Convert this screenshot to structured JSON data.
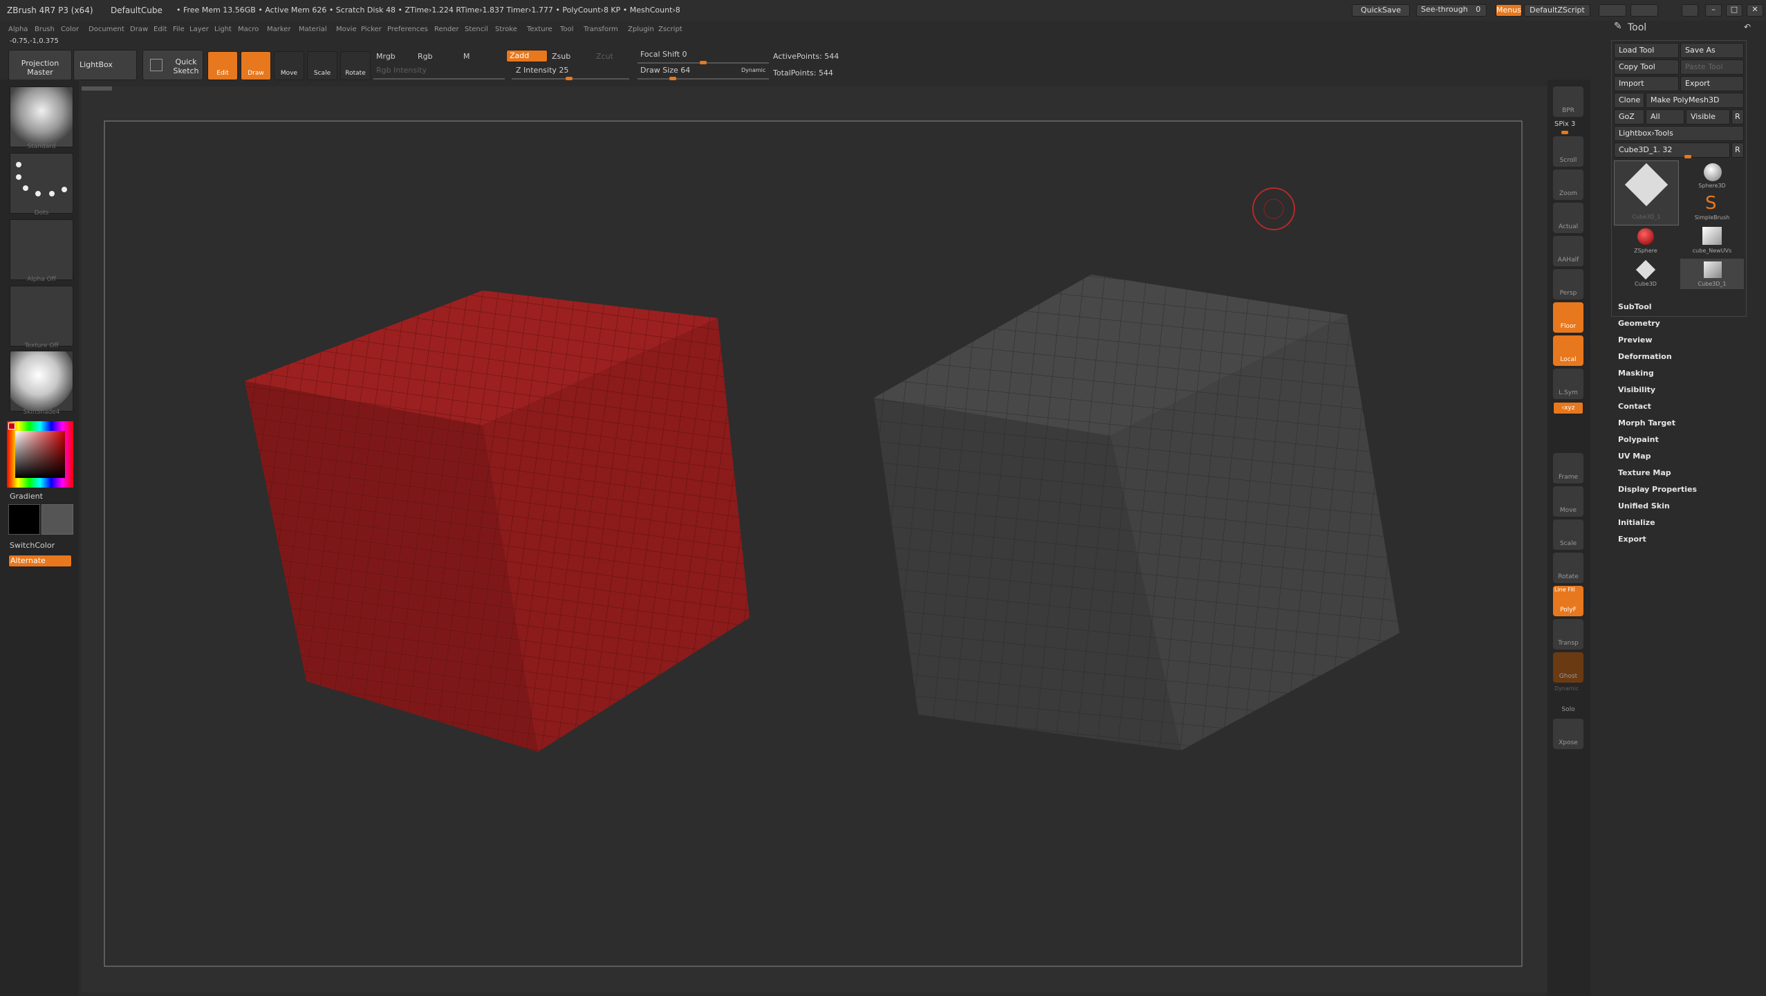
{
  "title_bar": {
    "app": "ZBrush 4R7 P3 (x64)",
    "document": "DefaultCube",
    "stats": "• Free Mem 13.56GB • Active Mem 626 • Scratch Disk 48 • ZTime›1.224 RTime›1.837 Timer›1.777 • PolyCount›8 KP • MeshCount›8",
    "quicksave": "QuickSave",
    "seethrough": "See-through",
    "seethrough_value": "0",
    "menus": "Menus",
    "script": "DefaultZScript"
  },
  "menu": [
    "Alpha",
    "Brush",
    "Color",
    "Document",
    "Draw",
    "Edit",
    "File",
    "Layer",
    "Light",
    "Macro",
    "Marker",
    "Material",
    "Movie",
    "Picker",
    "Preferences",
    "Render",
    "Stencil",
    "Stroke",
    "Texture",
    "Tool",
    "Transform",
    "Zplugin",
    "Zscript"
  ],
  "coords": "-0.75,-1,0.375",
  "toolbar": {
    "projection_master": "Projection Master",
    "lightbox": "LightBox",
    "quick_sketch": "Quick Sketch",
    "edit": "Edit",
    "draw": "Draw",
    "move": "Move",
    "scale": "Scale",
    "rotate": "Rotate",
    "mrgb": "Mrgb",
    "rgb": "Rgb",
    "m": "M",
    "rgb_intensity": "Rgb Intensity",
    "zadd": "Zadd",
    "zsub": "Zsub",
    "zcut": "Zcut",
    "z_intensity": "Z Intensity 25",
    "focal_shift": "Focal Shift 0",
    "draw_size": "Draw Size 64",
    "dynamic": "Dynamic",
    "active_points": "ActivePoints: 544",
    "total_points": "TotalPoints: 544"
  },
  "left_shelf": {
    "brush": "Standard",
    "stroke": "Dots",
    "alpha": "Alpha Off",
    "texture": "Texture Off",
    "material": "SkinShade4",
    "gradient": "Gradient",
    "switchcolor": "SwitchColor",
    "alternate": "Alternate"
  },
  "right_shelf": [
    {
      "name": "bpr",
      "label": "BPR"
    },
    {
      "name": "spix",
      "label": "SPix 3"
    },
    {
      "name": "scroll",
      "label": "Scroll"
    },
    {
      "name": "zoom",
      "label": "Zoom"
    },
    {
      "name": "actual",
      "label": "Actual"
    },
    {
      "name": "aahalf",
      "label": "AAHalf"
    },
    {
      "name": "persp",
      "label": "Persp"
    },
    {
      "name": "floor",
      "label": "Floor"
    },
    {
      "name": "local",
      "label": "Local"
    },
    {
      "name": "lsym",
      "label": "L.Sym"
    },
    {
      "name": "xyz",
      "label": "‹xyz"
    },
    {
      "name": "frame",
      "label": "Frame"
    },
    {
      "name": "move",
      "label": "Move"
    },
    {
      "name": "scale",
      "label": "Scale"
    },
    {
      "name": "rotate",
      "label": "Rotate"
    },
    {
      "name": "polyf",
      "label": "PolyF"
    },
    {
      "name": "linefill",
      "label": "Line Fill"
    },
    {
      "name": "transp",
      "label": "Transp"
    },
    {
      "name": "ghost",
      "label": "Ghost"
    },
    {
      "name": "dynamic",
      "label": "Dynamic"
    },
    {
      "name": "solo",
      "label": "Solo"
    },
    {
      "name": "xpose",
      "label": "Xpose"
    }
  ],
  "tool_panel": {
    "title": "Tool",
    "load_tool": "Load Tool",
    "save_as": "Save As",
    "copy_tool": "Copy Tool",
    "paste_tool": "Paste Tool",
    "import": "Import",
    "export": "Export",
    "clone": "Clone",
    "make_polymesh": "Make PolyMesh3D",
    "goz": "GoZ",
    "all": "All",
    "visible": "Visible",
    "r": "R",
    "lightbox_tools": "Lightbox›Tools",
    "current_tool": "Cube3D_1. 32",
    "tools": [
      "Cube3D_1",
      "Sphere3D",
      "SimpleBrush",
      "ZSphere",
      "cube_NewUVs",
      "Cube3D",
      "Cube3D_1"
    ],
    "subpalettes": [
      "SubTool",
      "Geometry",
      "Preview",
      "Deformation",
      "Masking",
      "Visibility",
      "Contact",
      "Morph Target",
      "Polypaint",
      "UV Map",
      "Texture Map",
      "Display Properties",
      "Unified Skin",
      "Initialize",
      "Export"
    ]
  },
  "colors": {
    "accent": "#e8781d",
    "red_cube": "#8c1b1b",
    "gray_cube": "#3d3d3d"
  }
}
